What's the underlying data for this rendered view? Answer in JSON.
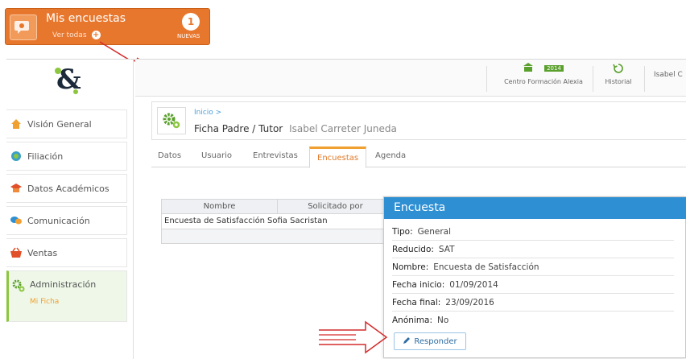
{
  "callout": {
    "title": "Mis encuestas",
    "link": "Ver todas",
    "count": "1",
    "badge": "NUEVAS",
    "accent": "#e8772e"
  },
  "topbar": {
    "center": {
      "label": "Centro Formación Alexia",
      "year": "2014"
    },
    "history": {
      "label": "Historial"
    },
    "user": "Isabel C"
  },
  "sidebar": {
    "items": [
      {
        "label": "Visión General",
        "icon": "home-icon"
      },
      {
        "label": "Filiación",
        "icon": "id-icon"
      },
      {
        "label": "Datos Académicos",
        "icon": "graduation-cap-icon"
      },
      {
        "label": "Comunicación",
        "icon": "chat-icon"
      },
      {
        "label": "Ventas",
        "icon": "basket-icon"
      },
      {
        "label": "Administración",
        "icon": "gears-icon"
      }
    ],
    "subitem": "Mi Ficha"
  },
  "header": {
    "breadcrumb": "Inicio >",
    "title": "Ficha Padre / Tutor",
    "person": "Isabel Carreter Juneda"
  },
  "tabs": [
    "Datos",
    "Usuario",
    "Entrevistas",
    "Encuestas",
    "Agenda"
  ],
  "table": {
    "columns": [
      "Nombre",
      "Solicitado por"
    ],
    "rows": [
      [
        "Encuesta de Satisfacción",
        "Sofia Sacristan"
      ]
    ]
  },
  "modal": {
    "title": "Encuesta",
    "fields": [
      {
        "label": "Tipo:",
        "value": "General"
      },
      {
        "label": "Reducido:",
        "value": "SAT"
      },
      {
        "label": "Nombre:",
        "value": "Encuesta de Satisfacción"
      },
      {
        "label": "Fecha inicio:",
        "value": "01/09/2014"
      },
      {
        "label": "Fecha final:",
        "value": "23/09/2016"
      },
      {
        "label": "Anónima:",
        "value": "No"
      }
    ],
    "button": "Responder"
  }
}
